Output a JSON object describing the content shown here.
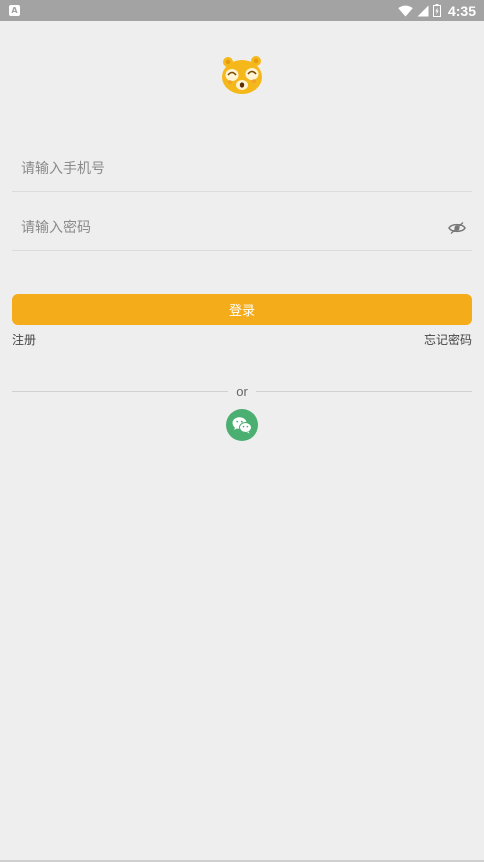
{
  "status_bar": {
    "left_icon": "A",
    "time": "4:35",
    "icons": [
      "wifi-icon",
      "signal-icon",
      "battery-icon"
    ]
  },
  "logo": {
    "icon": "bear-logo-icon",
    "color": "#f5b81b"
  },
  "form": {
    "phone_placeholder": "请输入手机号",
    "password_placeholder": "请输入密码",
    "password_visibility_icon": "eye-icon"
  },
  "actions": {
    "login_label": "登录",
    "register_label": "注册",
    "forgot_label": "忘记密码"
  },
  "divider": {
    "text": "or"
  },
  "social": {
    "wechat_icon": "wechat-icon",
    "wechat_color": "#4caf72"
  },
  "colors": {
    "accent": "#f5ac1b",
    "background": "#eeeeee",
    "status_bar": "#a3a3a3"
  }
}
